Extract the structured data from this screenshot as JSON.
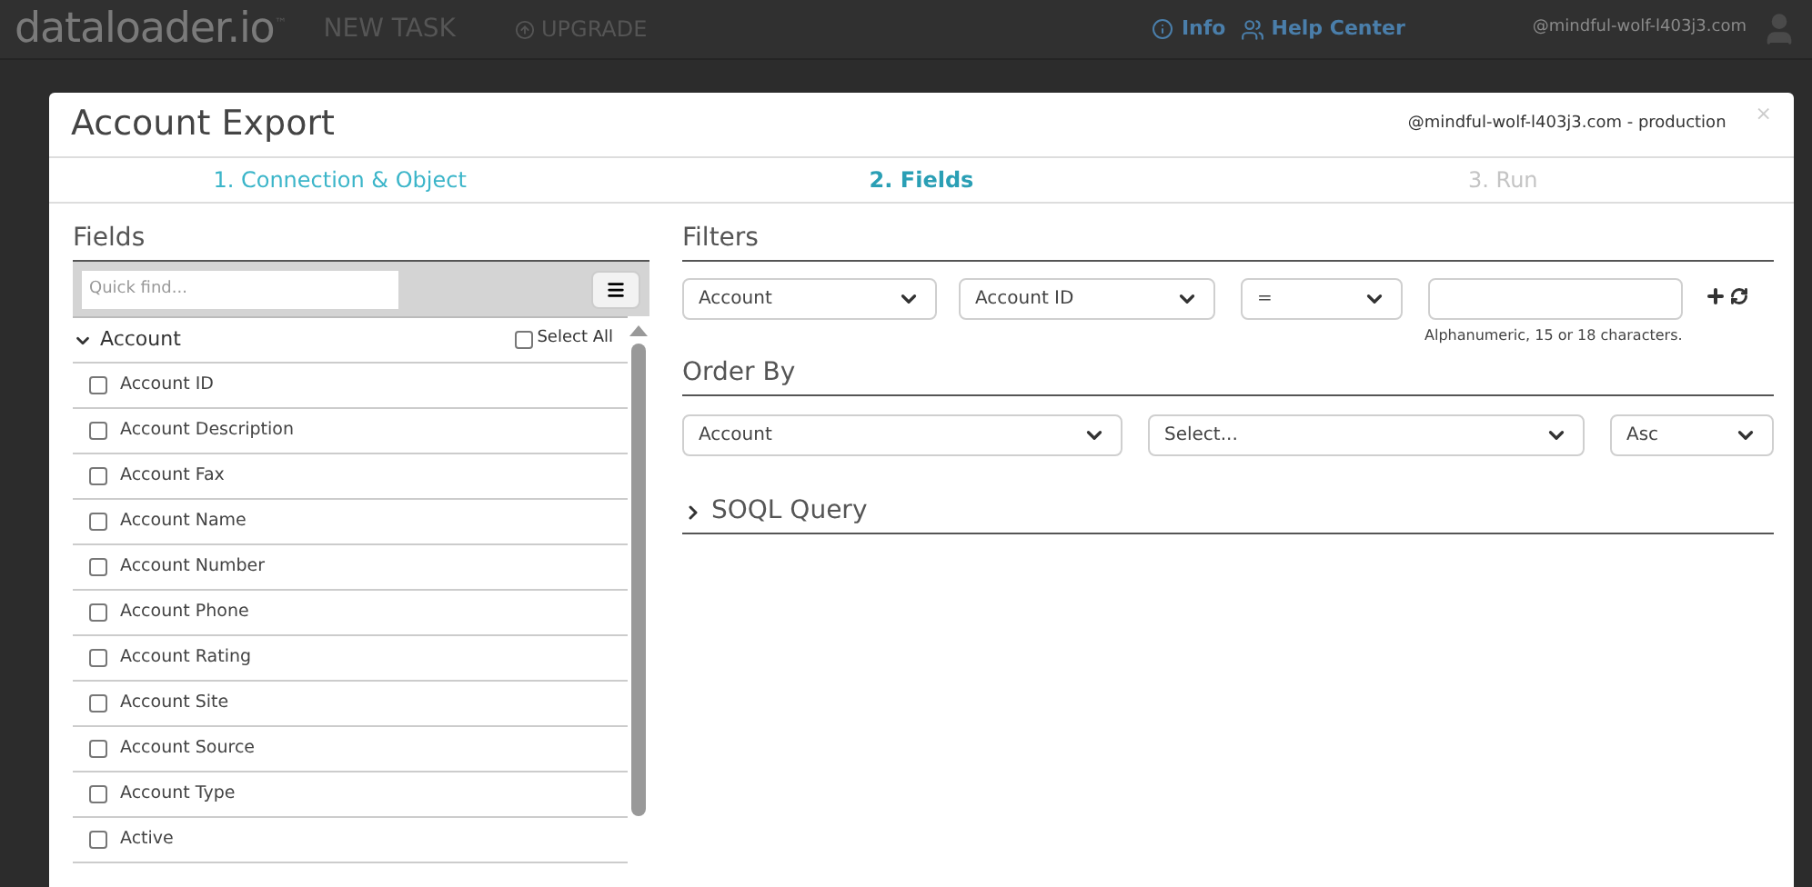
{
  "navbar": {
    "logo": "dataloader.io",
    "logo_mark": "™",
    "new_task": "NEW TASK",
    "upgrade": "UPGRADE",
    "info": "Info",
    "help_center": "Help Center",
    "user": "@mindful-wolf-l403j3.com"
  },
  "dialog": {
    "title": "Account Export",
    "connection": "@mindful-wolf-l403j3.com - production",
    "close": "×"
  },
  "steps": [
    {
      "label": "1. Connection & Object",
      "selected": false,
      "disabled": false
    },
    {
      "label": "2. Fields",
      "selected": true,
      "disabled": false
    },
    {
      "label": "3. Run",
      "selected": false,
      "disabled": true
    }
  ],
  "fields_panel": {
    "heading": "Fields",
    "search": {
      "placeholder": "Quick find..."
    },
    "group": {
      "label": "Account",
      "expanded": true,
      "select_all": {
        "label": "Select All",
        "checked": false
      }
    },
    "items": [
      {
        "label": "Account ID",
        "checked": false
      },
      {
        "label": "Account Description",
        "checked": false
      },
      {
        "label": "Account Fax",
        "checked": false
      },
      {
        "label": "Account Name",
        "checked": false
      },
      {
        "label": "Account Number",
        "checked": false
      },
      {
        "label": "Account Phone",
        "checked": false
      },
      {
        "label": "Account Rating",
        "checked": false
      },
      {
        "label": "Account Site",
        "checked": false
      },
      {
        "label": "Account Source",
        "checked": false
      },
      {
        "label": "Account Type",
        "checked": false
      },
      {
        "label": "Active",
        "checked": false
      }
    ]
  },
  "filters": {
    "heading": "Filters",
    "object": "Account",
    "field": "Account ID",
    "operator": "=",
    "value_hint": "Alphanumeric, 15 or 18 characters."
  },
  "order_by": {
    "heading": "Order By",
    "object": "Account",
    "field": "Select...",
    "direction": "Asc"
  },
  "soql_query": {
    "label": "SOQL Query",
    "expanded": false
  }
}
